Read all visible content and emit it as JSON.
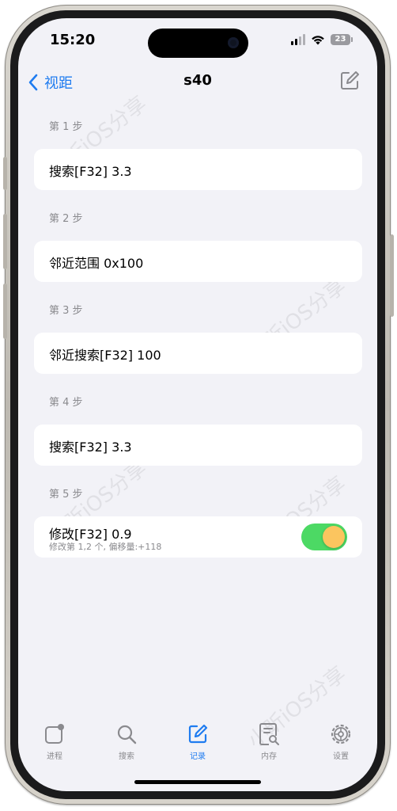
{
  "status_bar": {
    "time": "15:20",
    "battery": "23"
  },
  "nav": {
    "back_label": "视距",
    "title": "s40"
  },
  "steps": [
    {
      "header": "第 1 步",
      "title": "搜索[F32] 3.3"
    },
    {
      "header": "第 2 步",
      "title": "邻近范围 0x100"
    },
    {
      "header": "第 3 步",
      "title": "邻近搜索[F32] 100"
    },
    {
      "header": "第 4 步",
      "title": "搜索[F32] 3.3"
    },
    {
      "header": "第 5 步",
      "title": "修改[F32] 0.9",
      "subtitle": "修改第 1,2 个, 偏移量:+118",
      "toggle_on": true
    }
  ],
  "tabs": [
    {
      "label": "进程",
      "icon": "process-icon"
    },
    {
      "label": "搜索",
      "icon": "search-icon"
    },
    {
      "label": "记录",
      "icon": "record-edit-icon",
      "active": true
    },
    {
      "label": "内存",
      "icon": "memory-icon"
    },
    {
      "label": "设置",
      "icon": "settings-gear-icon"
    }
  ],
  "watermark": "小昕iOS分享",
  "colors": {
    "accent": "#1f7cf0",
    "toggle_on": "#4cd964",
    "toggle_knob": "#fbc55f",
    "background": "#f2f2f7"
  }
}
